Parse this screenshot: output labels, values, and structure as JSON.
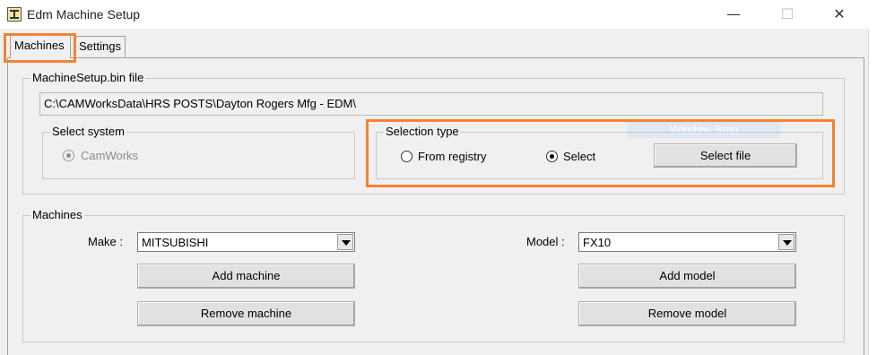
{
  "window": {
    "title": "Edm Machine Setup",
    "minimize_glyph": "—",
    "maximize_glyph": "☐",
    "close_glyph": "✕"
  },
  "tabs": [
    {
      "label": "Machines",
      "active": true
    },
    {
      "label": "Settings",
      "active": false
    }
  ],
  "file_group": {
    "label": "MachineSetup.bin file",
    "path": "C:\\CAMWorksData\\HRS POSTS\\Dayton Rogers Mfg - EDM\\"
  },
  "select_system": {
    "label": "Select system",
    "option": "CamWorks",
    "checked": true,
    "enabled": false
  },
  "selection_type": {
    "label": "Selection type",
    "options": [
      {
        "label": "From registry",
        "checked": false
      },
      {
        "label": "Select",
        "checked": true
      }
    ],
    "select_file_label": "Select file"
  },
  "watermark": "Window Snip",
  "machines": {
    "label": "Machines",
    "make_label": "Make :",
    "make_value": "MITSUBISHI",
    "model_label": "Model :",
    "model_value": "FX10",
    "add_machine_label": "Add machine",
    "remove_machine_label": "Remove machine",
    "add_model_label": "Add model",
    "remove_model_label": "Remove model"
  },
  "colors": {
    "highlight": "#f58233",
    "background": "#f0f0f0"
  }
}
